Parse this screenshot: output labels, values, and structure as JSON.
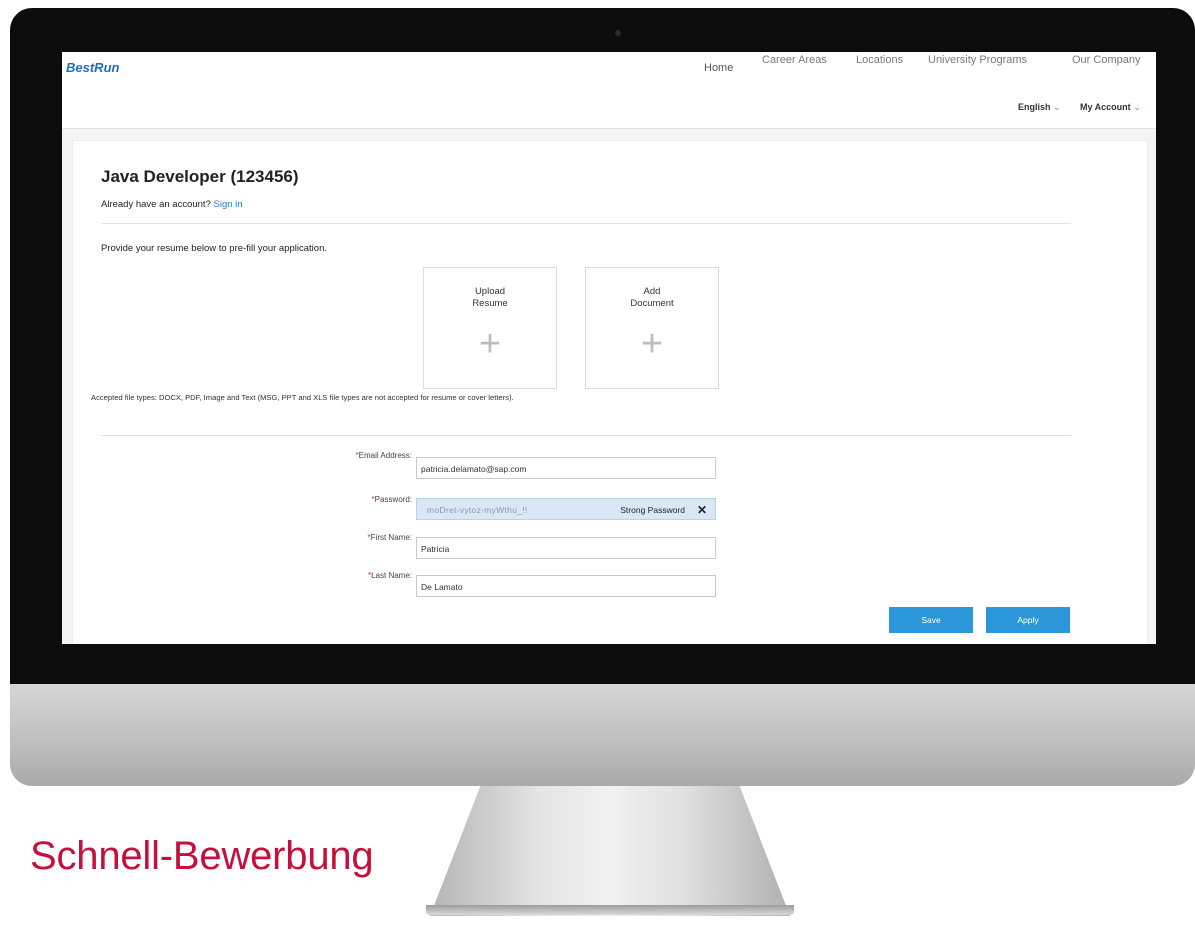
{
  "brand": {
    "logo_text": "BestRun"
  },
  "nav": {
    "home": "Home",
    "items": [
      "Career Areas",
      "Locations",
      "University Programs",
      "Our Company"
    ],
    "language": "English",
    "account": "My Account",
    "chevron": "chevron-down-icon"
  },
  "job": {
    "title": "Java Developer (123456)",
    "already_account": "Already have an account?",
    "sign_in": "Sign in"
  },
  "resume": {
    "intro": "Provide your resume below to pre-fill your application.",
    "upload_label": "Upload\nResume",
    "add_doc_label": "Add\nDocument",
    "plus_icon": "plus-icon",
    "accepted_types": "Accepted file types: DOCX, PDF, Image and Text (MSG, PPT and XLS file types are not accepted for resume or cover letters)."
  },
  "form": {
    "required_mark": "*",
    "email_label": "Email Address:",
    "email_value": "patricia.delamato@sap.com",
    "password_label": "Password:",
    "password_value": "moDret-vytoz-myWthu_!!",
    "password_strength": "Strong Password",
    "first_name_label": "First Name:",
    "first_name_value": "Patricia",
    "last_name_label": "Last Name:",
    "last_name_value": "De Lamato"
  },
  "actions": {
    "save": "Save",
    "apply": "Apply"
  },
  "caption": "Schnell-Bewerbung",
  "colors": {
    "accent": "#2b97d9",
    "link": "#1f7bd0",
    "caption": "#c4103a",
    "required": "#d32f2f"
  }
}
